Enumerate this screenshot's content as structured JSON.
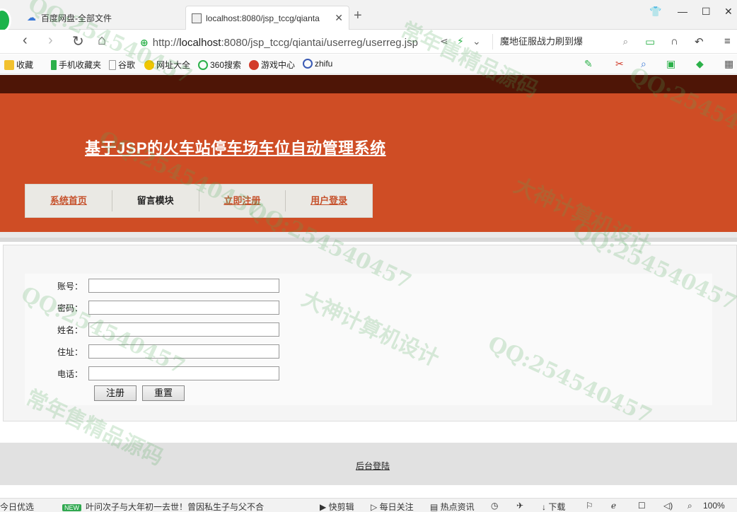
{
  "browser": {
    "tabs": [
      {
        "title": "百度网盘-全部文件",
        "active": false
      },
      {
        "title": "localhost:8080/jsp_tccg/qianta",
        "active": true
      }
    ],
    "address": {
      "scheme": "http://",
      "host": "localhost",
      "path": ":8080/jsp_tccg/qiantai/userreg/userreg.jsp"
    },
    "search_text": "魔地征服战力刷到爆",
    "bookmarks": [
      "收藏",
      "手机收藏夹",
      "谷歌",
      "网址大全",
      "360搜索",
      "游戏中心",
      "zhifu"
    ]
  },
  "site": {
    "title": "基于JSP的火车站停车场车位自动管理系统",
    "nav": [
      {
        "label": "系统首页",
        "style": "link"
      },
      {
        "label": "留言模块",
        "style": "plain"
      },
      {
        "label": "立即注册",
        "style": "link"
      },
      {
        "label": "用户登录",
        "style": "link"
      }
    ]
  },
  "form": {
    "fields": [
      {
        "label": "账号：",
        "value": ""
      },
      {
        "label": "密码：",
        "value": ""
      },
      {
        "label": "姓名：",
        "value": ""
      },
      {
        "label": "住址：",
        "value": ""
      },
      {
        "label": "电话：",
        "value": ""
      }
    ],
    "submit_label": "注册",
    "reset_label": "重置"
  },
  "footer": {
    "admin_link": "后台登陆"
  },
  "statusbar": {
    "left": "今日优选",
    "new_badge": "NEW",
    "news": "叶问次子与大年初一去世！曾因私生子与父不合",
    "items": [
      "快剪辑",
      "每日关注",
      "热点资讯",
      "下载"
    ],
    "zoom": "100%"
  },
  "colors": {
    "header_bg": "#cf4d25",
    "top_band": "#4e1506",
    "nav_link": "#c6512b",
    "nav_bg": "#eae9e4"
  }
}
